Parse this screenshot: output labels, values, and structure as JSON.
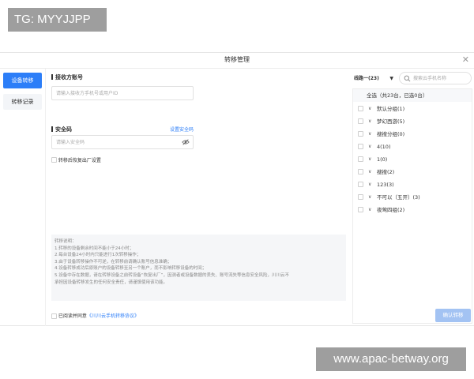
{
  "watermarks": {
    "top": "TG: MYYJJPP",
    "bottom": "www.apac-betway.org"
  },
  "window": {
    "title": "转移管理"
  },
  "sidebar": {
    "items": [
      {
        "label": "设备转移"
      },
      {
        "label": "转移记录"
      }
    ]
  },
  "form": {
    "receiver_label": "接收方账号",
    "receiver_placeholder": "请输入接收方手机号或用户ID",
    "security_label": "安全码",
    "security_link": "设置安全码",
    "security_placeholder": "请输入安全码",
    "restore_label": "转移后恢复出厂设置"
  },
  "notes": {
    "lines": [
      "转移说明：",
      "1.转移的设备剩余时间不能小于24小时；",
      "2.每台设备24小时内只能进行1次转移操作；",
      "3.由于设备转移操作不可逆，在转移前请确认账号信息准确；",
      "4.设备转移成功后原账户的设备转移至另一个账户，而不影响转移设备的时间；",
      "5.设备中存在数据，请在转移设备之前转设备“恢复出厂”，因测者或设备数据的丢失、账号流失等信息安全风险，川川云不",
      "承担因设备转移发生的任何安全责任，请谨慎使用该功能。"
    ]
  },
  "agree": {
    "prefix": "已阅读并同意",
    "link": "《川川云手机转移协议》"
  },
  "right": {
    "select_value": "线路一(23)",
    "search_placeholder": "搜索云手机名称",
    "select_all": "全选（共23台，已选0台）",
    "groups": [
      {
        "label": "默认分组(1)"
      },
      {
        "label": "梦幻西游(5)"
      },
      {
        "label": "搜搜分组(0)"
      },
      {
        "label": "4(10)"
      },
      {
        "label": "1(0)"
      },
      {
        "label": "搜搜(2)"
      },
      {
        "label": "123(3)"
      },
      {
        "label": "不可以（五开）(3)"
      },
      {
        "label": "夜莺四组(2)"
      }
    ]
  },
  "buttons": {
    "confirm": "确认转移"
  },
  "colors": {
    "accent": "#2c7ef8",
    "confirm_disabled": "#a3c3f3"
  }
}
